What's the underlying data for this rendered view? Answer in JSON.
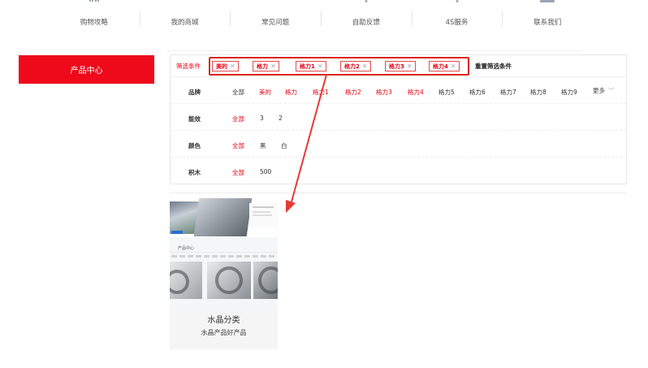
{
  "nav": {
    "items": [
      {
        "label": "购物攻略",
        "mark": "dots"
      },
      {
        "label": "我的商城",
        "mark": "none"
      },
      {
        "label": "常见问题",
        "mark": "none"
      },
      {
        "label": "自助反馈",
        "mark": "dot"
      },
      {
        "label": "4S服务",
        "mark": "dot"
      },
      {
        "label": "联系我们",
        "mark": "bar"
      }
    ]
  },
  "sidebar": {
    "title": "产品中心"
  },
  "filter": {
    "selected_label": "筛选条件",
    "selected": [
      {
        "label": "美的"
      },
      {
        "label": "格力"
      },
      {
        "label": "格力1"
      },
      {
        "label": "格力2"
      },
      {
        "label": "格力3"
      },
      {
        "label": "格力4"
      }
    ],
    "reset_label": "重置筛选条件",
    "rows": [
      {
        "name": "品牌",
        "values": [
          "全部",
          "美的",
          "格力",
          "格力1",
          "格力2",
          "格力3",
          "格力4",
          "格力5",
          "格力6",
          "格力7",
          "格力8",
          "格力9"
        ],
        "more": "更多"
      },
      {
        "name": "能效",
        "values": [
          "全部",
          "3",
          "2"
        ]
      },
      {
        "name": "颜色",
        "values": [
          "全部",
          "黑",
          "白"
        ]
      },
      {
        "name": "积木",
        "values": [
          "全部",
          "500"
        ]
      }
    ]
  },
  "product": {
    "thumb_title": "产品中心",
    "title": "水晶分类",
    "subtitle": "水晶产品好产品"
  },
  "colors": {
    "accent": "#ee0a1b",
    "annotation": "#e53935"
  },
  "icons": {
    "close": "close-icon",
    "more": "chevron-down-icon",
    "arrow": "annotation-arrow"
  }
}
